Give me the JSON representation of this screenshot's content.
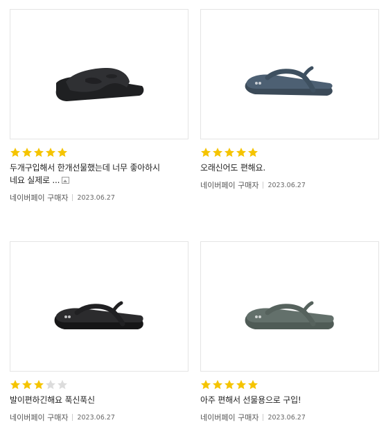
{
  "reviews": [
    {
      "rating": 5,
      "text_line1": "두개구입해서 한개선물했는데 너무 좋아하시",
      "text_line2": "네요 실제로 ...",
      "has_photo": true,
      "buyer": "네이버페이 구매자",
      "date": "2023.06.27",
      "product_color": "#2f3033"
    },
    {
      "rating": 5,
      "text_line1": "오래신어도 편해요.",
      "text_line2": "",
      "has_photo": false,
      "buyer": "네이버페이 구매자",
      "date": "2023.06.27",
      "product_color": "#4d6073"
    },
    {
      "rating": 3,
      "text_line1": "발이편하긴해요 푹신푹신",
      "text_line2": "",
      "has_photo": false,
      "buyer": "네이버페이 구매자",
      "date": "2023.06.27",
      "product_color": "#2b2b2d"
    },
    {
      "rating": 5,
      "text_line1": "아주 편해서 선물용으로 구입!",
      "text_line2": "",
      "has_photo": false,
      "buyer": "네이버페이 구매자",
      "date": "2023.06.27",
      "product_color": "#63706b"
    }
  ],
  "colors": {
    "star_filled": "#f5c400",
    "star_empty": "#dcdcdc"
  },
  "icons": {
    "star": "star-icon",
    "photo": "photo-icon"
  }
}
